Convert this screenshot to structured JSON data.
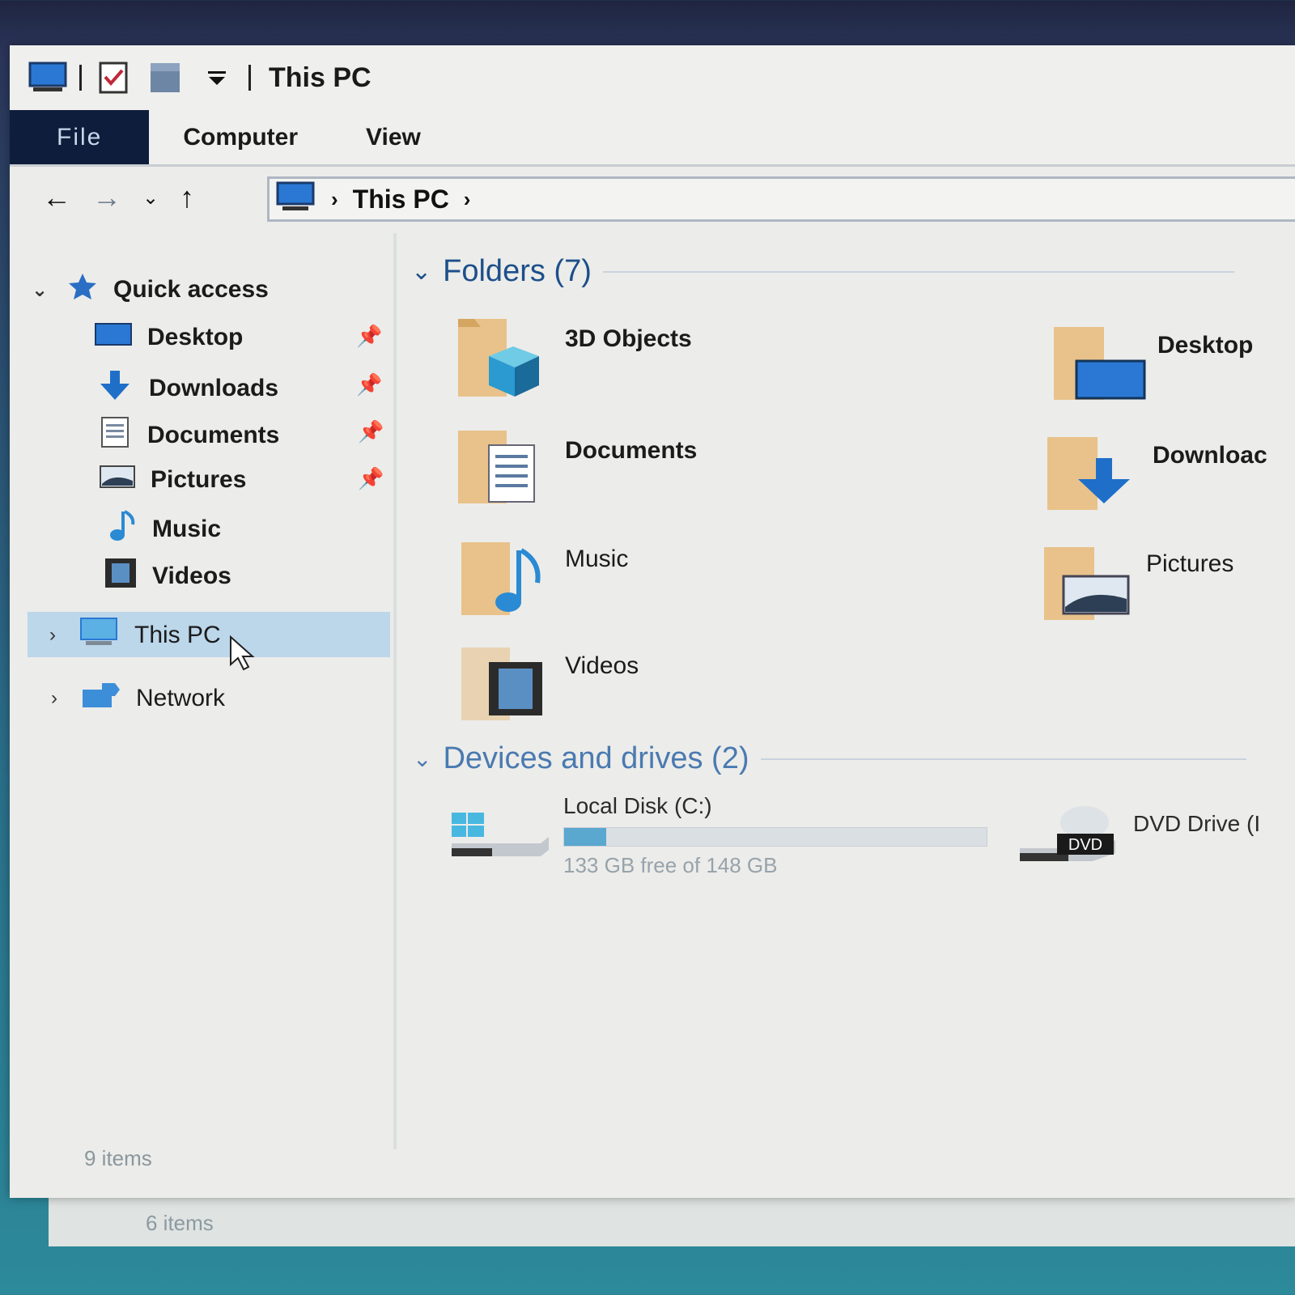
{
  "titlebar": {
    "title": "This PC"
  },
  "ribbon": {
    "tabs": [
      "File",
      "Computer",
      "View"
    ]
  },
  "address": {
    "crumb": "This PC"
  },
  "sidebar": {
    "quick_access": "Quick access",
    "items": [
      "Desktop",
      "Downloads",
      "Documents",
      "Pictures",
      "Music",
      "Videos"
    ],
    "this_pc": "This PC",
    "network": "Network"
  },
  "folders": {
    "heading": "Folders (7)",
    "items": [
      "3D Objects",
      "Desktop",
      "Documents",
      "Downloac",
      "Music",
      "Pictures",
      "Videos"
    ]
  },
  "devices": {
    "heading": "Devices and drives (2)",
    "local_disk": {
      "label": "Local Disk (C:)",
      "free_text": "133 GB free of 148 GB",
      "used_fraction": 0.1
    },
    "dvd": {
      "label": "DVD Drive (I",
      "badge": "DVD"
    }
  },
  "status": {
    "items": "9 items",
    "back_items": "6 items"
  },
  "colors": {
    "accent": "#1d4f8a",
    "file_tab": "#0f1d3c",
    "selection": "#bcd6ea",
    "folder": "#e8c28a",
    "blue_icon": "#2a78d4"
  }
}
